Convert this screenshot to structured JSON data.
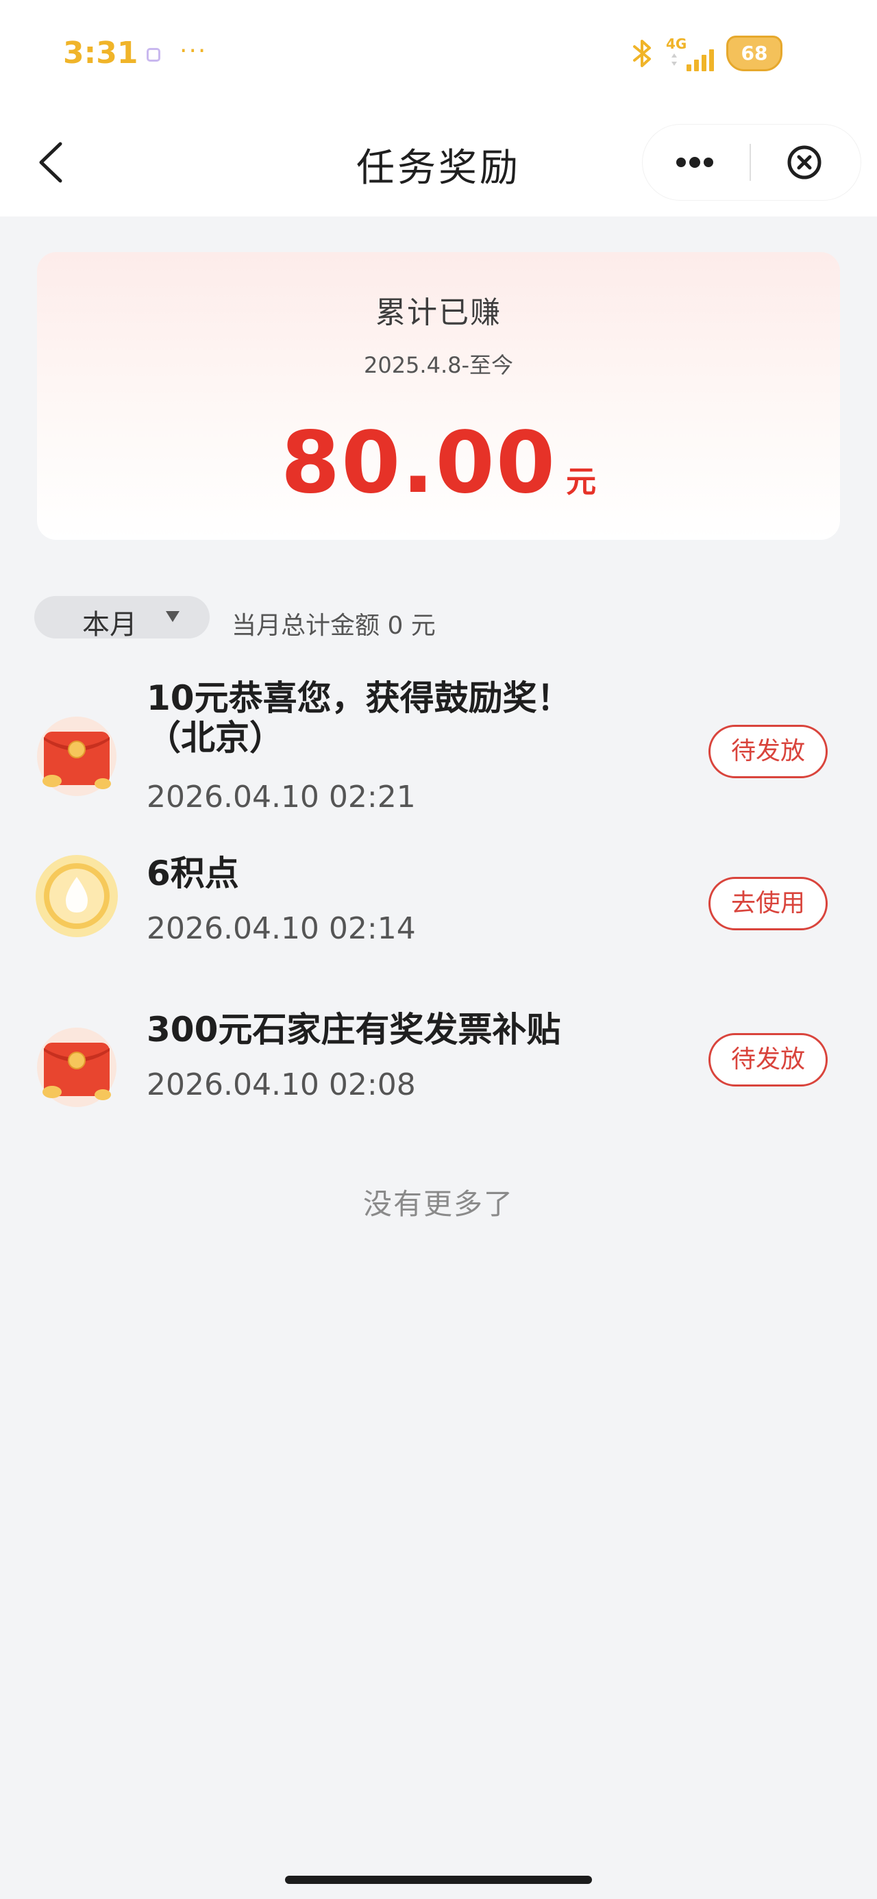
{
  "status_bar": {
    "time": "3:31",
    "dots": "···",
    "network": "4G",
    "battery": "68"
  },
  "nav": {
    "title": "任务奖励",
    "more_icon": "more-dots-icon",
    "close_icon": "close-circle-icon",
    "back_icon": "chevron-left-icon"
  },
  "summary": {
    "title": "累计已赚",
    "period": "2025.4.8-至今",
    "amount": "80.00",
    "unit": "元"
  },
  "filter": {
    "month_label": "本月",
    "month_total": "当月总计金额 0 元"
  },
  "rewards": [
    {
      "title": "10元恭喜您，获得鼓励奖！（北京）",
      "time": "2026.04.10 02:21",
      "action": "待发放",
      "icon": "red-envelope-icon"
    },
    {
      "title": "6积点",
      "time": "2026.04.10 02:14",
      "action": "去使用",
      "icon": "points-drop-icon"
    },
    {
      "title": "300元石家庄有奖发票补贴",
      "time": "2026.04.10 02:08",
      "action": "待发放",
      "icon": "red-envelope-icon"
    }
  ],
  "footer": {
    "no_more": "没有更多了"
  },
  "colors": {
    "accent_red": "#e63228",
    "status_yellow": "#f0b429",
    "page_bg": "#f3f4f6"
  }
}
